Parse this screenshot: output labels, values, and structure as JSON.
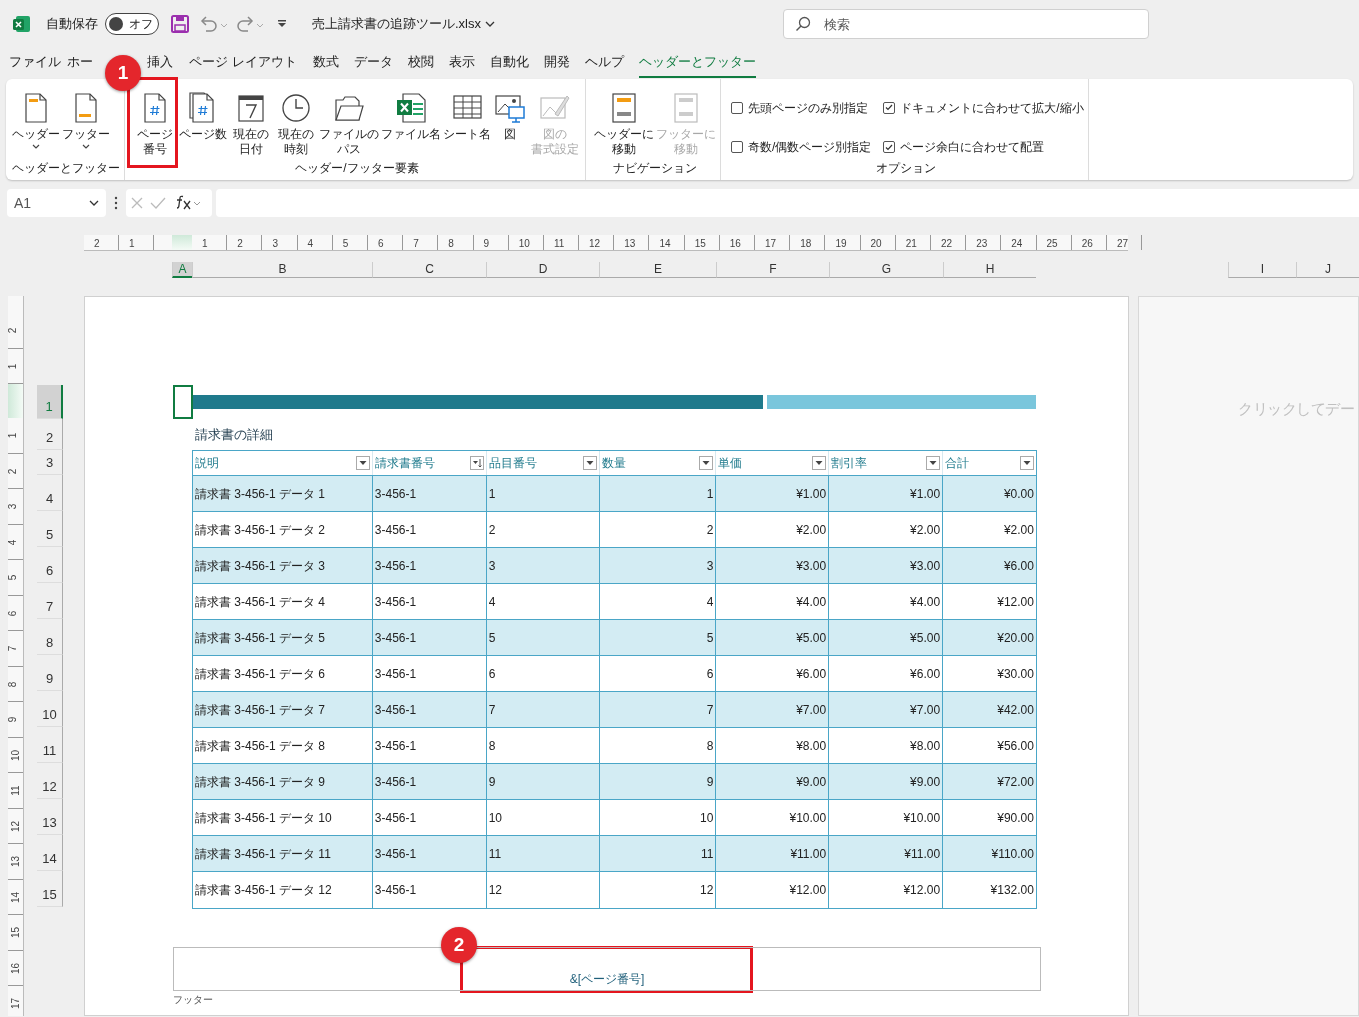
{
  "title_bar": {
    "autosave_label": "自動保存",
    "autosave": {
      "label": "オフ",
      "on": false
    },
    "filename": "売上請求書の追跡ツール.xlsx",
    "search": {
      "placeholder": "検索"
    }
  },
  "menu_tabs": [
    {
      "label": "ファイル",
      "selected": false
    },
    {
      "label": "ホー",
      "selected": false
    },
    {
      "label": "挿入",
      "selected": false
    },
    {
      "label": "ページ レイアウト",
      "selected": false
    },
    {
      "label": "数式",
      "selected": false
    },
    {
      "label": "データ",
      "selected": false
    },
    {
      "label": "校閲",
      "selected": false
    },
    {
      "label": "表示",
      "selected": false
    },
    {
      "label": "自動化",
      "selected": false
    },
    {
      "label": "開発",
      "selected": false
    },
    {
      "label": "ヘルプ",
      "selected": false
    },
    {
      "label": "ヘッダーとフッター",
      "selected": true
    }
  ],
  "ribbon": {
    "groups": [
      {
        "label": "ヘッダーとフッター",
        "kind": "buttons",
        "buttons": [
          {
            "label_lines": [
              "ヘッダー"
            ],
            "dropdown": true,
            "disabled": false
          },
          {
            "label_lines": [
              "フッター"
            ],
            "dropdown": true,
            "disabled": false
          }
        ]
      },
      {
        "label": "ヘッダー/フッター要素",
        "kind": "buttons",
        "buttons": [
          {
            "label_lines": [
              "ページ",
              "番号"
            ],
            "dropdown": false,
            "disabled": false
          },
          {
            "label_lines": [
              "ページ数"
            ],
            "dropdown": false,
            "disabled": false
          },
          {
            "label_lines": [
              "現在の",
              "日付"
            ],
            "dropdown": false,
            "disabled": false
          },
          {
            "label_lines": [
              "現在の",
              "時刻"
            ],
            "dropdown": false,
            "disabled": false
          },
          {
            "label_lines": [
              "ファイルの",
              "パス"
            ],
            "dropdown": false,
            "disabled": false
          },
          {
            "label_lines": [
              "ファイル名"
            ],
            "dropdown": false,
            "disabled": false
          },
          {
            "label_lines": [
              "シート名"
            ],
            "dropdown": false,
            "disabled": false
          },
          {
            "label_lines": [
              "図"
            ],
            "dropdown": false,
            "disabled": false
          },
          {
            "label_lines": [
              "図の",
              "書式設定"
            ],
            "dropdown": false,
            "disabled": true
          }
        ]
      },
      {
        "label": "ナビゲーション",
        "kind": "buttons",
        "buttons": [
          {
            "label_lines": [
              "ヘッダーに",
              "移動"
            ],
            "dropdown": false,
            "disabled": false
          },
          {
            "label_lines": [
              "フッターに",
              "移動"
            ],
            "dropdown": false,
            "disabled": true
          }
        ]
      },
      {
        "label": "オプション",
        "kind": "options",
        "options": [
          {
            "label": "先頭ページのみ別指定",
            "checked": false
          },
          {
            "label": "ドキュメントに合わせて拡大/縮小",
            "checked": true
          },
          {
            "label": "奇数/偶数ページ別指定",
            "checked": false
          },
          {
            "label": "ページ余白に合わせて配置",
            "checked": true
          }
        ]
      }
    ]
  },
  "formula_bar": {
    "name_box": "A1"
  },
  "ruler_top": {
    "before": [
      "2",
      "1"
    ],
    "after": [
      "1",
      "2",
      "3",
      "4",
      "5",
      "6",
      "7",
      "8",
      "9",
      "10",
      "11",
      "12",
      "13",
      "14",
      "15",
      "16",
      "17",
      "18",
      "19",
      "20",
      "21",
      "22",
      "23",
      "24",
      "25",
      "26",
      "27"
    ]
  },
  "ruler_left": {
    "before": [
      "2",
      "1"
    ],
    "after": [
      "1",
      "2",
      "3",
      "4",
      "5",
      "6",
      "7",
      "8",
      "9",
      "10",
      "11",
      "12",
      "13",
      "14",
      "15",
      "16",
      "17"
    ]
  },
  "column_headers": [
    {
      "label": "A",
      "selected": true
    },
    {
      "label": "B",
      "selected": false
    },
    {
      "label": "C",
      "selected": false
    },
    {
      "label": "D",
      "selected": false
    },
    {
      "label": "E",
      "selected": false
    },
    {
      "label": "F",
      "selected": false
    },
    {
      "label": "G",
      "selected": false
    },
    {
      "label": "H",
      "selected": false
    },
    {
      "label": "I",
      "selected": false
    },
    {
      "label": "J",
      "selected": false
    }
  ],
  "row_headers": [
    {
      "label": "1",
      "selected": true
    },
    {
      "label": "2",
      "selected": false
    },
    {
      "label": "3",
      "selected": false
    },
    {
      "label": "4",
      "selected": false
    },
    {
      "label": "5",
      "selected": false
    },
    {
      "label": "6",
      "selected": false
    },
    {
      "label": "7",
      "selected": false
    },
    {
      "label": "8",
      "selected": false
    },
    {
      "label": "9",
      "selected": false
    },
    {
      "label": "10",
      "selected": false
    },
    {
      "label": "11",
      "selected": false
    },
    {
      "label": "12",
      "selected": false
    },
    {
      "label": "13",
      "selected": false
    },
    {
      "label": "14",
      "selected": false
    },
    {
      "label": "15",
      "selected": false
    }
  ],
  "page": {
    "section_title": "請求書の詳細",
    "table": {
      "columns": [
        {
          "label": "説明",
          "kind": "text",
          "sorted": false
        },
        {
          "label": "請求書番号",
          "kind": "text",
          "sorted": true
        },
        {
          "label": "品目番号",
          "kind": "text",
          "sorted": false
        },
        {
          "label": "数量",
          "kind": "number",
          "sorted": false
        },
        {
          "label": "単価",
          "kind": "number",
          "sorted": false
        },
        {
          "label": "割引率",
          "kind": "number",
          "sorted": false
        },
        {
          "label": "合計",
          "kind": "number",
          "sorted": false
        }
      ],
      "rows": [
        [
          "請求書 3-456-1 データ 1",
          "3-456-1",
          "1",
          "1",
          "¥1.00",
          "¥1.00",
          "¥0.00"
        ],
        [
          "請求書 3-456-1 データ 2",
          "3-456-1",
          "2",
          "2",
          "¥2.00",
          "¥2.00",
          "¥2.00"
        ],
        [
          "請求書 3-456-1 データ 3",
          "3-456-1",
          "3",
          "3",
          "¥3.00",
          "¥3.00",
          "¥6.00"
        ],
        [
          "請求書 3-456-1 データ 4",
          "3-456-1",
          "4",
          "4",
          "¥4.00",
          "¥4.00",
          "¥12.00"
        ],
        [
          "請求書 3-456-1 データ 5",
          "3-456-1",
          "5",
          "5",
          "¥5.00",
          "¥5.00",
          "¥20.00"
        ],
        [
          "請求書 3-456-1 データ 6",
          "3-456-1",
          "6",
          "6",
          "¥6.00",
          "¥6.00",
          "¥30.00"
        ],
        [
          "請求書 3-456-1 データ 7",
          "3-456-1",
          "7",
          "7",
          "¥7.00",
          "¥7.00",
          "¥42.00"
        ],
        [
          "請求書 3-456-1 データ 8",
          "3-456-1",
          "8",
          "8",
          "¥8.00",
          "¥8.00",
          "¥56.00"
        ],
        [
          "請求書 3-456-1 データ 9",
          "3-456-1",
          "9",
          "9",
          "¥9.00",
          "¥9.00",
          "¥72.00"
        ],
        [
          "請求書 3-456-1 データ 10",
          "3-456-1",
          "10",
          "10",
          "¥10.00",
          "¥10.00",
          "¥90.00"
        ],
        [
          "請求書 3-456-1 データ 11",
          "3-456-1",
          "11",
          "11",
          "¥11.00",
          "¥11.00",
          "¥110.00"
        ],
        [
          "請求書 3-456-1 データ 12",
          "3-456-1",
          "12",
          "12",
          "¥12.00",
          "¥12.00",
          "¥132.00"
        ]
      ]
    },
    "footer": {
      "text": "&[ページ番号]",
      "label": "フッター"
    }
  },
  "next_page": {
    "placeholder": "クリックしてデー"
  },
  "callouts": [
    "1",
    "2"
  ]
}
